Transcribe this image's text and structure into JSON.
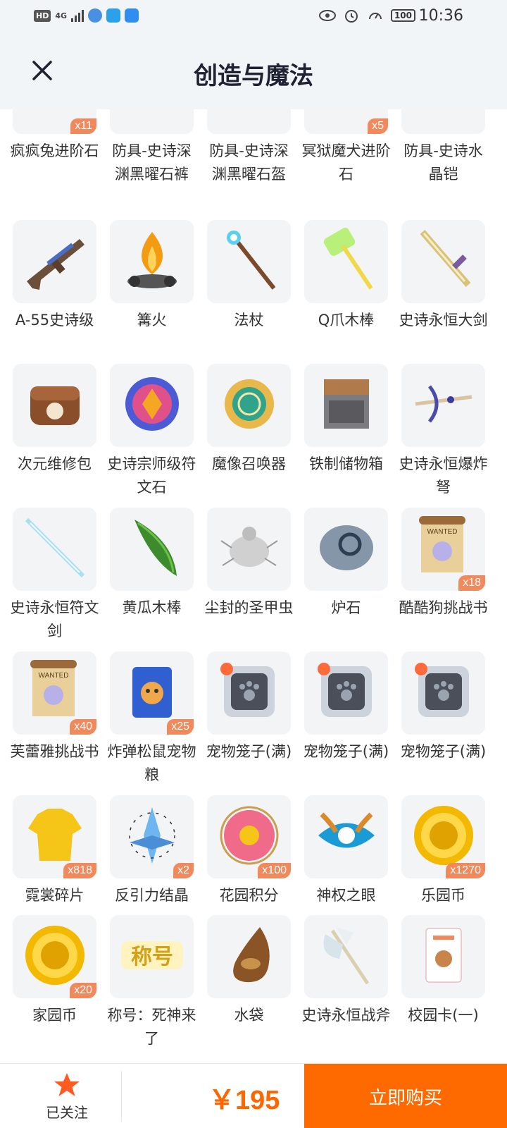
{
  "status_bar": {
    "hd": "HD",
    "net": "4G",
    "battery": "100",
    "time": "10:36"
  },
  "header": {
    "title": "创造与魔法",
    "close_icon": "close-icon"
  },
  "rows": [
    [
      {
        "name": "疯疯兔进阶石",
        "badge": "x11",
        "icon": "gem-icon"
      },
      {
        "name": "防具-史诗深渊黑曜石裤",
        "badge": "",
        "icon": "armor-icon"
      },
      {
        "name": "防具-史诗深渊黑曜石盔",
        "badge": "",
        "icon": "armor-icon"
      },
      {
        "name": "冥狱魔犬进阶石",
        "badge": "x5",
        "icon": "gem-icon"
      },
      {
        "name": "防具-史诗水晶铠",
        "badge": "",
        "icon": "armor-icon"
      }
    ],
    [
      {
        "name": "A-55史诗级",
        "badge": "",
        "icon": "gun-icon"
      },
      {
        "name": "篝火",
        "badge": "",
        "icon": "campfire-icon"
      },
      {
        "name": "法杖",
        "badge": "",
        "icon": "staff-icon"
      },
      {
        "name": "Q爪木棒",
        "badge": "",
        "icon": "hammer-icon"
      },
      {
        "name": "史诗永恒大剑",
        "badge": "",
        "icon": "sword-icon"
      }
    ],
    [
      {
        "name": "次元维修包",
        "badge": "",
        "icon": "bag-icon"
      },
      {
        "name": "史诗宗师级符文石",
        "badge": "",
        "icon": "rune-icon"
      },
      {
        "name": "魔像召唤器",
        "badge": "",
        "icon": "summoner-icon"
      },
      {
        "name": "铁制储物箱",
        "badge": "",
        "icon": "chest-icon"
      },
      {
        "name": "史诗永恒爆炸弩",
        "badge": "",
        "icon": "crossbow-icon"
      }
    ],
    [
      {
        "name": "史诗永恒符文剑",
        "badge": "",
        "icon": "crystal-sword-icon"
      },
      {
        "name": "黄瓜木棒",
        "badge": "",
        "icon": "cucumber-icon"
      },
      {
        "name": "尘封的圣甲虫",
        "badge": "",
        "icon": "beetle-icon"
      },
      {
        "name": "炉石",
        "badge": "",
        "icon": "stone-icon"
      },
      {
        "name": "酷酷狗挑战书",
        "badge": "x18",
        "icon": "wanted-scroll-icon"
      }
    ],
    [
      {
        "name": "芙蕾雅挑战书",
        "badge": "x40",
        "icon": "wanted-scroll-icon"
      },
      {
        "name": "炸弹松鼠宠物粮",
        "badge": "x25",
        "icon": "pet-food-icon"
      },
      {
        "name": "宠物笼子(满)",
        "badge": "",
        "icon": "pet-cage-icon"
      },
      {
        "name": "宠物笼子(满)",
        "badge": "",
        "icon": "pet-cage-icon"
      },
      {
        "name": "宠物笼子(满)",
        "badge": "",
        "icon": "pet-cage-icon"
      }
    ],
    [
      {
        "name": "霓裳碎片",
        "badge": "x818",
        "icon": "shirt-icon"
      },
      {
        "name": "反引力结晶",
        "badge": "x2",
        "icon": "crystal-icon"
      },
      {
        "name": "花园积分",
        "badge": "x100",
        "icon": "flower-icon"
      },
      {
        "name": "神权之眼",
        "badge": "",
        "icon": "eye-icon"
      },
      {
        "name": "乐园币",
        "badge": "x1270",
        "icon": "coin-icon"
      }
    ],
    [
      {
        "name": "家园币",
        "badge": "x20",
        "icon": "coin-icon"
      },
      {
        "name": "称号：死神来了",
        "badge": "",
        "icon": "title-badge-icon",
        "tile_text": "称号"
      },
      {
        "name": "水袋",
        "badge": "",
        "icon": "water-bag-icon"
      },
      {
        "name": "史诗永恒战斧",
        "badge": "",
        "icon": "axe-icon"
      },
      {
        "name": "校园卡(一)",
        "badge": "",
        "icon": "card-icon"
      }
    ]
  ],
  "bottom": {
    "follow_label": "已关注",
    "follow_icon": "star-icon",
    "price": "￥195",
    "buy_label": "立即购买"
  },
  "colors": {
    "accent": "#ff6a00",
    "price": "#ff6600",
    "badge": "#f08a5d",
    "header_bg": "#f2f5f8",
    "tile_bg": "#f3f4f6"
  }
}
